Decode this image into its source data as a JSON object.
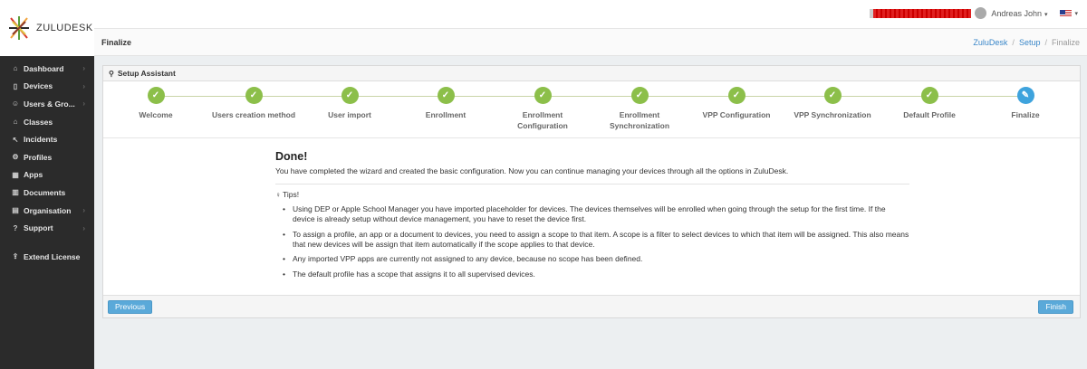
{
  "app": {
    "logo_text": "ZULUDESK"
  },
  "topbar": {
    "user_name": "Andreas John",
    "user_caret": "▾",
    "lang_caret": "▾"
  },
  "sidebar": {
    "items": [
      {
        "label": "Dashboard",
        "icon": "home-icon",
        "glyph": "⌂",
        "chevron": "›"
      },
      {
        "label": "Devices",
        "icon": "device-icon",
        "glyph": "▯",
        "chevron": "›"
      },
      {
        "label": "Users & Gro...",
        "icon": "users-icon",
        "glyph": "☺",
        "chevron": "›"
      },
      {
        "label": "Classes",
        "icon": "graduation-cap-icon",
        "glyph": "⌂",
        "chevron": ""
      },
      {
        "label": "Incidents",
        "icon": "incident-icon",
        "glyph": "↖",
        "chevron": ""
      },
      {
        "label": "Profiles",
        "icon": "gears-icon",
        "glyph": "⚙",
        "chevron": ""
      },
      {
        "label": "Apps",
        "icon": "apps-grid-icon",
        "glyph": "▦",
        "chevron": ""
      },
      {
        "label": "Documents",
        "icon": "books-icon",
        "glyph": "▥",
        "chevron": ""
      },
      {
        "label": "Organisation",
        "icon": "building-icon",
        "glyph": "▤",
        "chevron": "›"
      },
      {
        "label": "Support",
        "icon": "question-circle-icon",
        "glyph": "?",
        "chevron": "›"
      }
    ],
    "extend_license": {
      "label": "Extend License",
      "icon": "extend-license-icon",
      "glyph": "⇪"
    }
  },
  "page": {
    "title": "Finalize",
    "breadcrumb": [
      "ZuluDesk",
      "Setup",
      "Finalize"
    ]
  },
  "panel": {
    "title": "Setup Assistant",
    "title_icon": "wand-icon"
  },
  "steps": [
    {
      "label": "Welcome",
      "state": "done"
    },
    {
      "label": "Users creation method",
      "state": "done"
    },
    {
      "label": "User import",
      "state": "done"
    },
    {
      "label": "Enrollment",
      "state": "done"
    },
    {
      "label": "Enrollment\nConfiguration",
      "state": "done"
    },
    {
      "label": "Enrollment\nSynchronization",
      "state": "done"
    },
    {
      "label": "VPP Configuration",
      "state": "done"
    },
    {
      "label": "VPP Synchronization",
      "state": "done"
    },
    {
      "label": "Default Profile",
      "state": "done"
    },
    {
      "label": "Finalize",
      "state": "active"
    }
  ],
  "content": {
    "heading": "Done!",
    "text": "You have completed the wizard and created the basic configuration. Now you can continue managing your devices through all the options in ZuluDesk.",
    "tips_label": "Tips!",
    "tips": [
      "Using DEP or Apple School Manager you have imported placeholder for devices. The devices themselves will be enrolled when going through the setup for the first time. If the device is already setup without device management, you have to reset the device first.",
      "To assign a profile, an app or a document to devices, you need to assign a scope to that item. A scope is a filter to select devices to which that item will be assigned. This also means that new devices will be assign that item automatically if the scope applies to that device.",
      "Any imported VPP apps are currently not assigned to any device, because no scope has been defined.",
      "The default profile has a scope that assigns it to all supervised devices."
    ]
  },
  "buttons": {
    "previous": "Previous",
    "finish": "Finish"
  },
  "colors": {
    "sidebar_bg": "#2b2b2b",
    "step_done": "#8cbf4a",
    "step_active": "#3ea3dd",
    "button": "#5aa9d9",
    "link": "#3a87c9"
  }
}
